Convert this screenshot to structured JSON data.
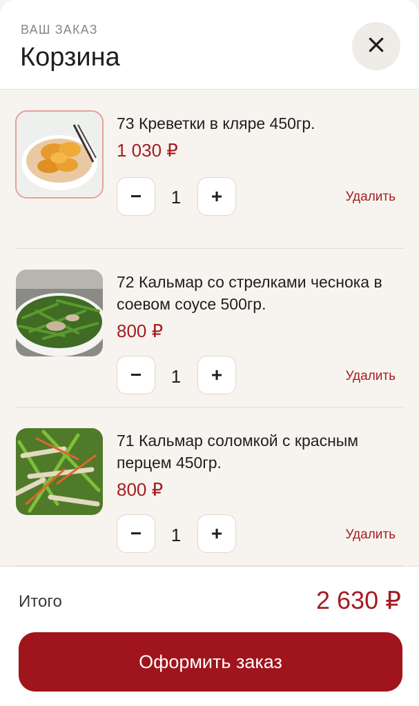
{
  "header": {
    "eyebrow": "ВАШ ЗАКАЗ",
    "title": "Корзина",
    "close_icon": "close-icon"
  },
  "cart": {
    "items": [
      {
        "name": "73 Креветки в кляре 450гр.",
        "price": "1 030 ₽",
        "quantity": "1",
        "minus": "−",
        "plus": "+",
        "remove": "Удалить",
        "image": "shrimp-in-batter-image"
      },
      {
        "name": "72 Кальмар со стрелками чеснока в соевом соусе 500гр.",
        "price": "800 ₽",
        "quantity": "1",
        "minus": "−",
        "plus": "+",
        "remove": "Удалить",
        "image": "squid-garlic-shoots-image"
      },
      {
        "name": "71 Кальмар соломкой с красным перцем 450гр.",
        "price": "800 ₽",
        "quantity": "1",
        "minus": "−",
        "plus": "+",
        "remove": "Удалить",
        "image": "squid-strips-red-pepper-image"
      }
    ]
  },
  "footer": {
    "total_label": "Итого",
    "total_value": "2 630 ₽",
    "checkout_label": "Оформить заказ"
  },
  "colors": {
    "accent": "#a41c22",
    "button": "#a0141c",
    "background": "#f7f4ef"
  }
}
